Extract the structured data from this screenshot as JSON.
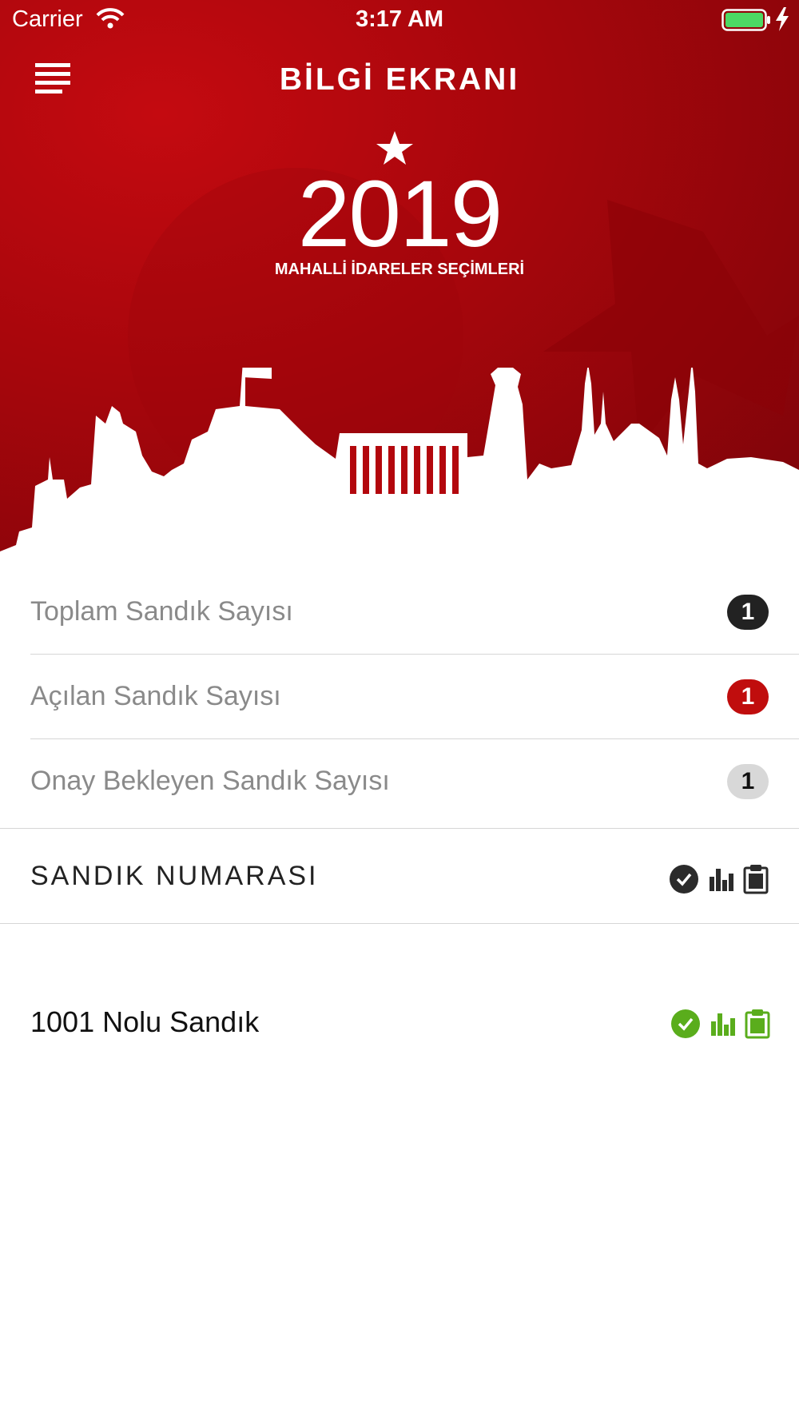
{
  "status_bar": {
    "carrier": "Carrier",
    "time": "3:17 AM"
  },
  "header": {
    "title": "BİLGİ EKRANI"
  },
  "logo": {
    "year": "2019",
    "subtitle": "MAHALLİ İDARELER SEÇİMLERİ"
  },
  "stats": [
    {
      "label": "Toplam Sandık Sayısı",
      "count": "1"
    },
    {
      "label": "Açılan Sandık Sayısı",
      "count": "1"
    },
    {
      "label": "Onay Bekleyen Sandık Sayısı",
      "count": "1"
    }
  ],
  "section": {
    "title": "SANDIK NUMARASI"
  },
  "sandiklar": [
    {
      "label": "1001 Nolu Sandık"
    }
  ],
  "icons": {
    "menu": "hamburger-menu-icon",
    "status": [
      "check-circle-icon",
      "bar-chart-icon",
      "clipboard-icon"
    ]
  },
  "colors": {
    "brand_red": "#c00d0d",
    "dark_badge": "#222222",
    "gray_badge": "#d8d8d8",
    "success_green": "#5aad1c",
    "battery_green": "#4cd964"
  }
}
